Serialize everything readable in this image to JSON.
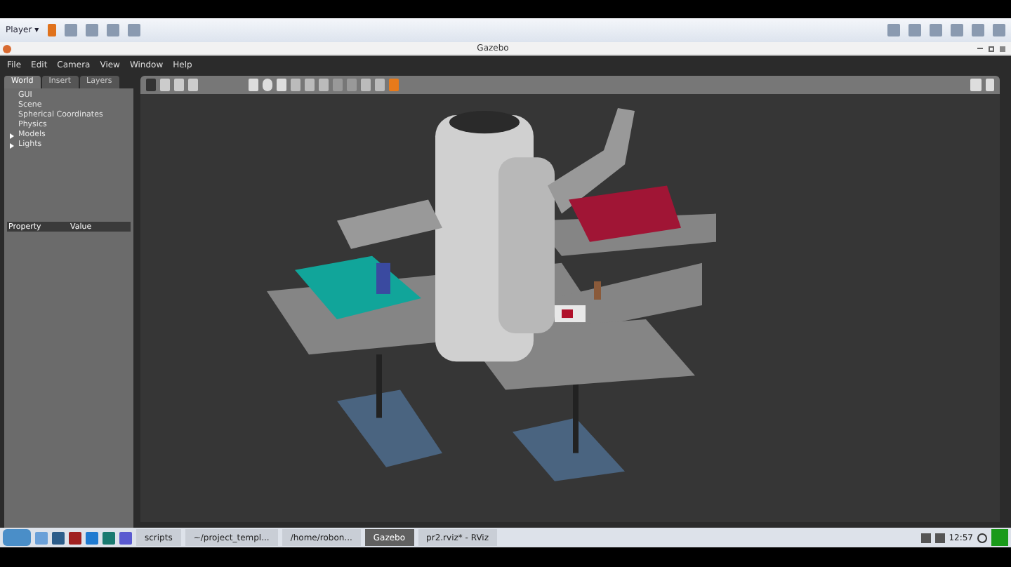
{
  "host_toolbar": {
    "player_menu": "Player",
    "player_menu_caret": "▾"
  },
  "window": {
    "title": "Gazebo"
  },
  "menu": [
    "File",
    "Edit",
    "Camera",
    "View",
    "Window",
    "Help"
  ],
  "tabs": [
    {
      "label": "World",
      "selected": true
    },
    {
      "label": "Insert",
      "selected": false
    },
    {
      "label": "Layers",
      "selected": false
    }
  ],
  "tree": [
    {
      "label": "GUI",
      "kind": "leaf"
    },
    {
      "label": "Scene",
      "kind": "leaf"
    },
    {
      "label": "Spherical Coordinates",
      "kind": "leaf"
    },
    {
      "label": "Physics",
      "kind": "leaf"
    },
    {
      "label": "Models",
      "kind": "group"
    },
    {
      "label": "Lights",
      "kind": "group"
    }
  ],
  "property_table": {
    "columns": [
      "Property",
      "Value"
    ]
  },
  "taskbar": {
    "windows": [
      {
        "label": "scripts",
        "selected": false
      },
      {
        "label": "~/project_templ...",
        "selected": false
      },
      {
        "label": "/home/robon...",
        "selected": false
      },
      {
        "label": "Gazebo",
        "selected": true
      },
      {
        "label": "pr2.rviz* - RViz",
        "selected": false
      }
    ],
    "clock": "12:57"
  }
}
